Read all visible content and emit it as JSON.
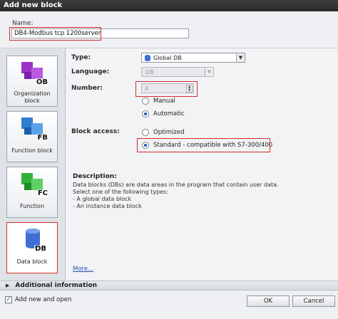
{
  "window": {
    "title": "Add new block"
  },
  "name_field": {
    "label": "Name:",
    "value": "DB4-Modbus tcp 1200server"
  },
  "blocks": [
    {
      "line1": "Organization",
      "line2": "block",
      "code": "OB",
      "color": "#9b32c8",
      "icon": "ob-block-icon"
    },
    {
      "line1": "",
      "line2": "Function block",
      "code": "FB",
      "color": "#2f7fd0",
      "icon": "fb-block-icon"
    },
    {
      "line1": "",
      "line2": "Function",
      "code": "FC",
      "color": "#32b23a",
      "icon": "fc-block-icon"
    },
    {
      "line1": "",
      "line2": "Data block",
      "code": "DB",
      "color": "#3e6fd6",
      "icon": "db-block-icon"
    }
  ],
  "form": {
    "type_label": "Type:",
    "type_value": "Global DB",
    "language_label": "Language:",
    "language_value": "DB",
    "number_label": "Number:",
    "number_value": "4",
    "radio_manual": "Manual",
    "radio_automatic": "Automatic",
    "access_label": "Block access:",
    "radio_optimized": "Optimized",
    "radio_standard": "Standard - compatible with S7-300/400"
  },
  "description": {
    "title": "Description:",
    "lines": [
      "Data blocks (DBs) are data areas in the program that contain user data.",
      "Select one of the following types:",
      "- A global data block",
      "- An instance data block"
    ],
    "more_link": "More..."
  },
  "additional_info": "Additional  information",
  "footer": {
    "add_new_open": "Add new and open",
    "ok": "OK",
    "cancel": "Cancel"
  },
  "colors": {
    "highlight": "#d62a2a",
    "selected_radio": "#1f4fb8"
  }
}
